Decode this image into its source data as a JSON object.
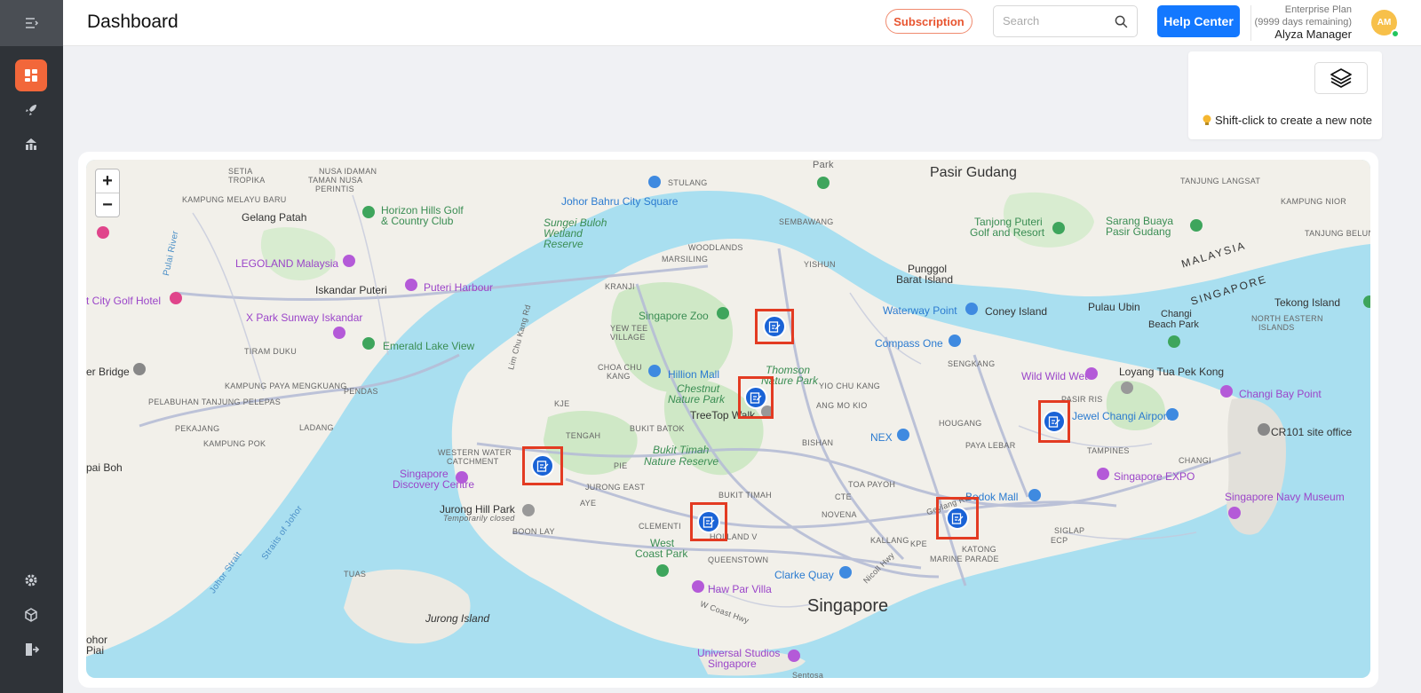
{
  "header": {
    "title": "Dashboard",
    "subscription_label": "Subscription",
    "search_placeholder": "Search",
    "help_label": "Help Center",
    "plan_name": "Enterprise Plan",
    "plan_remaining": "(9999 days remaining)",
    "user_name": "Alyza Manager",
    "avatar_initials": "AM"
  },
  "sidebar": {
    "items": [
      {
        "name": "dashboard",
        "icon": "grid-icon",
        "active": true
      },
      {
        "name": "launch",
        "icon": "rocket-icon"
      },
      {
        "name": "analytics",
        "icon": "chart-icon"
      },
      {
        "name": "settings",
        "icon": "gear-icon"
      },
      {
        "name": "packages",
        "icon": "cube-icon"
      },
      {
        "name": "logout",
        "icon": "logout-icon"
      }
    ]
  },
  "note_panel": {
    "layers_icon": "layers-icon",
    "hint": "Shift-click to create a new note"
  },
  "map": {
    "zoom_in": "+",
    "zoom_out": "−",
    "labels": {
      "johor_bahru": "Johor Bahru",
      "pasir_gudang": "Pasir Gudang",
      "gelang_patah": "Gelang Patah",
      "horizon_hills": "Horizon Hills Golf",
      "country_club": "& Country Club",
      "jb_city_square": "Johor Bahru City Square",
      "sungei_buloh_1": "Sungei Buloh",
      "sungei_buloh_2": "Wetland",
      "sungei_buloh_3": "Reserve",
      "legoland": "LEGOLAND Malaysia",
      "puteri_harbour": "Puteri Harbour",
      "iskandar_puteri": "Iskandar Puteri",
      "city_golf_hotel": "t City Golf Hotel",
      "x_park": "X Park Sunway Iskandar",
      "emerald_lake": "Emerald Lake View",
      "singapore_zoo": "Singapore Zoo",
      "hillion_mall": "Hillion Mall",
      "chestnut_1": "Chestnut",
      "chestnut_2": "Nature Park",
      "thomson_1": "Thomson",
      "thomson_2": "Nature Park",
      "treetop": "TreeTop Walk",
      "bukit_timah_1": "Bukit Timah",
      "bukit_timah_2": "Nature Reserve",
      "punggol_1": "Punggol",
      "punggol_2": "Barat Island",
      "waterway_point": "Waterway Point",
      "coney_island": "Coney Island",
      "compass_one": "Compass One",
      "pulau_ubin": "Pulau Ubin",
      "tekong_island": "Tekong Island",
      "changi_beach_1": "Changi",
      "changi_beach_2": "Beach Park",
      "wild_wild_wet": "Wild Wild Wet",
      "loyang": "Loyang Tua Pek Kong",
      "changi_bay": "Changi Bay Point",
      "jewel_changi": "Jewel Changi Airport",
      "cr101": "CR101 site office",
      "singapore_expo": "Singapore EXPO",
      "navy_museum": "Singapore Navy Museum",
      "bedok_mall": "Bedok Mall",
      "nex": "NEX",
      "singapore_discovery_1": "Singapore",
      "singapore_discovery_2": "Discovery Centre",
      "jurong_hill": "Jurong Hill Park",
      "temp_closed": "Temporarily closed",
      "west_coast_1": "West",
      "west_coast_2": "Coast Park",
      "clarke_quay": "Clarke Quay",
      "haw_par": "Haw Par Villa",
      "singapore": "Singapore",
      "jurong_island": "Jurong Island",
      "universal_1": "Universal Studios",
      "universal_2": "Singapore",
      "tanjong_puteri_1": "Tanjong Puteri",
      "tanjong_puteri_2": "Golf and Resort",
      "sarang_buaya_1": "Sarang Buaya",
      "sarang_buaya_2": "Pasir Gudang",
      "malaysia": "MALAYSIA",
      "singapore_caps": "SINGAPORE",
      "er_bridge": "er Bridge",
      "pai_boh_1": "pai Boh",
      "ohor_piai_1": "ohor",
      "ohor_piai_2": "Piai",
      "tuas": "TUAS",
      "boon_lay": "BOON LAY",
      "jurong_east": "JURONG EAST",
      "clementi": "CLEMENTI",
      "queenstown": "QUEENSTOWN",
      "holland": "HOLLAND V",
      "bukit_timah_town": "BUKIT TIMAH",
      "novena": "NOVENA",
      "toa_payoh": "TOA PAYOH",
      "kallang": "KALLANG",
      "marine_parade": "MARINE PARADE",
      "katong": "KATONG",
      "siglap": "SIGLAP",
      "tampines": "TAMPINES",
      "changi_town": "CHANGI",
      "pasir_ris": "PASIR RIS",
      "paya_lebar": "PAYA LEBAR",
      "hougang": "HOUGANG",
      "sengkang": "SENGKANG",
      "bishan": "BISHAN",
      "ang_mo_kio": "ANG MO KIO",
      "yio_chu_kang": "YIO CHU KANG",
      "yishun": "YISHUN",
      "sembawang": "SEMBAWANG",
      "woodlands": "WOODLANDS",
      "marsiling": "MARSILING",
      "kranji": "KRANJI",
      "yew_tee_1": "YEW TEE",
      "yew_tee_2": "VILLAGE",
      "choa_chu_kang_1": "CHOA CHU",
      "choa_chu_kang_2": "KANG",
      "bukit_batok": "BUKIT BATOK",
      "tengah": "TENGAH",
      "western_water_1": "WESTERN WATER",
      "western_water_2": "CATCHMENT",
      "stulang": "STULANG",
      "nusa_idaman": "NUSA IDAMAN",
      "taman_nusa_1": "TAMAN NUSA",
      "taman_nusa_2": "PERINTIS",
      "setia_tropika_1": "SETIA",
      "setia_tropika_2": "TROPIKA",
      "kampung_melayu": "KAMPUNG MELAYU BARU",
      "kampung_pendas": "PENDAS",
      "kampung_ladang": "LADANG",
      "kampung_pok": "KAMPUNG POK",
      "pekajang": "PEKAJANG",
      "pelabuhan": "PELABUHAN TANJUNG PELEPAS",
      "kampung_tiram": "TIRAM DUKU",
      "kampung_mongkek": "KAMPUNG PAYA MENGKUANG",
      "kampung_nior": "KAMPUNG NIOR",
      "tanjung_belungkor": "TANJUNG BELUNGKOR",
      "north_eastern_1": "NORTH EASTERN",
      "north_eastern_2": "ISLANDS",
      "tanjung_langsat": "TANJUNG LANGSAT",
      "pulai_river": "Pulai River",
      "lim_chu_kang": "Lim Chu Kang Rd",
      "johor_strait": "Johor Strait",
      "straits_johor": "Straits of Johor",
      "park": "Park",
      "ecp": "ECP",
      "aye": "AYE",
      "pie": "PIE",
      "kje": "KJE",
      "cte": "CTE",
      "kpe": "KPE",
      "geylang": "Geylang Rd",
      "w_coast": "W Coast Hwy",
      "nicoll": "Nicoll Hwy",
      "sentosa": "Sentosa"
    },
    "markers": [
      {
        "name": "note-marker-1",
        "icon": "note-icon"
      },
      {
        "name": "note-marker-2",
        "icon": "note-icon"
      },
      {
        "name": "note-marker-3",
        "icon": "note-icon"
      },
      {
        "name": "note-marker-4",
        "icon": "note-icon"
      },
      {
        "name": "note-marker-5",
        "icon": "note-icon"
      },
      {
        "name": "note-marker-6",
        "icon": "note-icon"
      }
    ]
  },
  "colors": {
    "sidebar_bg": "#2f3338",
    "accent": "#f2673a",
    "primary": "#1378ff",
    "marker_border": "#e33b22",
    "marker_pin": "#1a63d6",
    "water": "#a9dff0",
    "land": "#f2f0ea",
    "park": "#cfe8c6"
  }
}
